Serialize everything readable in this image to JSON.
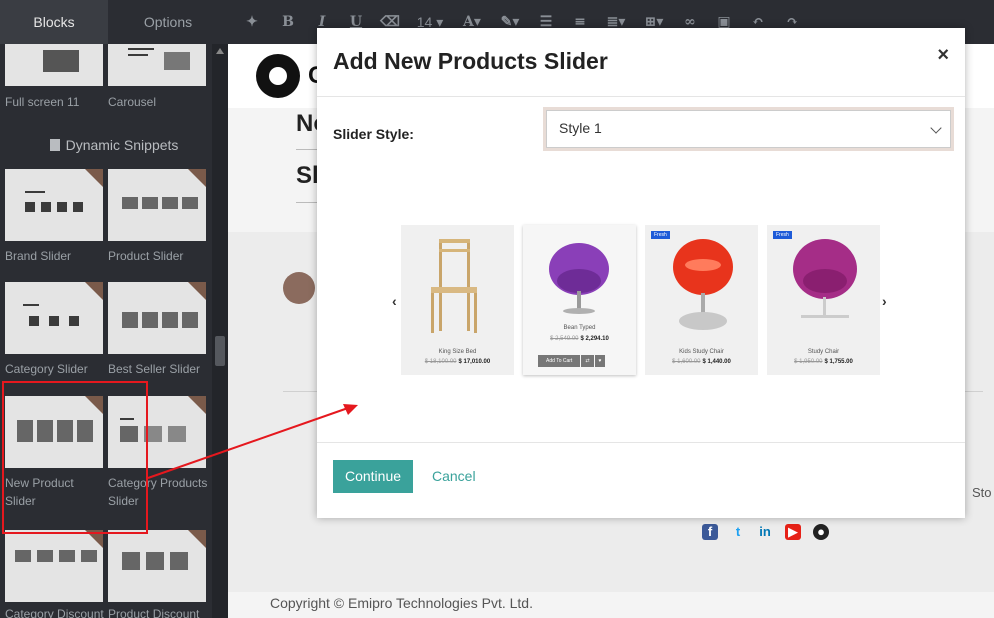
{
  "sidebar": {
    "tabs": [
      "Blocks",
      "Options"
    ],
    "section_title": "Dynamic Snippets",
    "snippets": {
      "full_screen": "Full screen 11",
      "carousel": "Carousel",
      "brand_slider": "Brand Slider",
      "product_slider": "Product Slider",
      "category_slider": "Category Slider",
      "best_seller_slider": "Best Seller Slider",
      "new_product_slider": "New Product Slider",
      "category_products_slider": "Category Products Slider",
      "category_discount": "Category Discount",
      "product_discount": "Product Discount"
    }
  },
  "toolbar": {
    "font_size": "14",
    "items": [
      "magic-wand-icon",
      "bold-icon",
      "italic-icon",
      "underline-icon",
      "eraser-icon",
      "font-size-select",
      "font-color-icon",
      "paint-brush-icon",
      "unordered-list-icon",
      "ordered-list-icon",
      "align-icon",
      "table-icon",
      "link-icon",
      "image-icon",
      "undo-icon",
      "redo-icon"
    ],
    "bold": "B",
    "italic": "I",
    "underline": "U",
    "font_color": "A"
  },
  "page": {
    "logo_text": "Cla",
    "heading_1": "No",
    "heading_2": "Sl",
    "store_fragment": "Sto",
    "copyright": "Copyright © Emipro Technologies Pvt. Ltd.",
    "social_icons": [
      "facebook-icon",
      "twitter-icon",
      "linkedin-icon",
      "youtube-icon",
      "github-icon"
    ]
  },
  "modal": {
    "title": "Add New Products Slider",
    "close": "×",
    "slider_style_label": "Slider Style:",
    "slider_style_value": "Style 1",
    "preview": {
      "products": [
        {
          "name": "King Size Bed",
          "old_price": "$ 18,100.00",
          "price": "$ 17,010.00",
          "tag": ""
        },
        {
          "name": "Bean Typed",
          "old_price": "$ 2,549.00",
          "price": "$ 2,294.10",
          "tag": "",
          "add_to_cart": "Add To Cart"
        },
        {
          "name": "Kids Study Chair",
          "old_price": "$ 1,600.00",
          "price": "$ 1,440.00",
          "tag": "Fresh"
        },
        {
          "name": "Study Chair",
          "old_price": "$ 1,950.00",
          "price": "$ 1,755.00",
          "tag": "Fresh"
        }
      ]
    },
    "continue_label": "Continue",
    "cancel_label": "Cancel"
  },
  "colors": {
    "accent": "#3aa29b",
    "highlight": "#e5181e",
    "sidebar_bg": "#2b2d33"
  }
}
